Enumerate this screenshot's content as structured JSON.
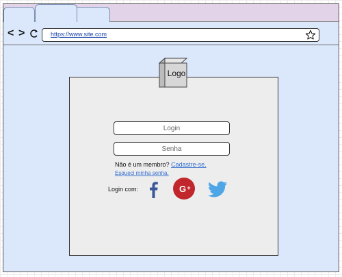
{
  "browser": {
    "tabs": [
      "",
      "",
      ""
    ],
    "nav": {
      "back_label": "<",
      "forward_label": ">"
    },
    "url": "https://www.site.com"
  },
  "login_panel": {
    "logo_label": "Logo",
    "login_placeholder": "Login",
    "password_placeholder": "Senha",
    "member_prompt": "Não é um membro?",
    "signup_link": "Cadastre-se.",
    "forgot_link": "Esqueci minha senha.",
    "login_with_label": "Login com:",
    "social": [
      "facebook-icon",
      "google-plus-icon",
      "twitter-icon"
    ]
  },
  "colors": {
    "page_bg": "#dbe8fb",
    "tabbar_bg": "#e3d3e8",
    "panel_bg": "#ededed",
    "link": "#3570d0",
    "facebook": "#3b5998",
    "google_plus": "#c0262b",
    "twitter": "#4ea6e6"
  }
}
